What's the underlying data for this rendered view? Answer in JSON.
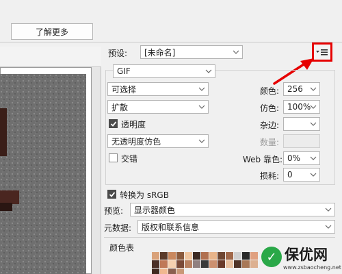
{
  "toolbar": {
    "learn_more_label": "了解更多"
  },
  "preset": {
    "label": "预设:",
    "value": "[未命名]"
  },
  "format": {
    "value": "GIF"
  },
  "palette": {
    "value": "可选择"
  },
  "dither": {
    "value": "扩散"
  },
  "transparency": {
    "label": "透明度",
    "checked": true
  },
  "matte_dither": {
    "value": "无透明度仿色"
  },
  "interlaced": {
    "label": "交错",
    "checked": false
  },
  "colors": {
    "label": "颜色:",
    "value": "256"
  },
  "dither_amount": {
    "label": "仿色:",
    "value": "100%"
  },
  "matte": {
    "label": "杂边:",
    "value": ""
  },
  "amount": {
    "label": "数量:",
    "value": ""
  },
  "web_snap": {
    "label": "Web 靠色:",
    "value": "0%"
  },
  "lossy": {
    "label": "损耗:",
    "value": "0"
  },
  "convert_srgb": {
    "label": "转换为 sRGB",
    "checked": true
  },
  "preview_mode": {
    "label": "预览:",
    "value": "显示器颜色"
  },
  "metadata": {
    "label": "元数据:",
    "value": "版权和联系信息"
  },
  "color_table": {
    "label": "颜色表",
    "swatches": [
      "#d9a27a",
      "#5a3a2a",
      "#c9885e",
      "#8a5a3c",
      "#f0c6a0",
      "#3c2a22",
      "#b07050",
      "#e8b48a",
      "#6e4632",
      "#a0684a",
      "#d0d0d0",
      "#2a2a2a",
      "#e0a080",
      "#4a3028",
      "#c07858",
      "#f5d0b0",
      "#7a4a38",
      "#b88060",
      "#908080",
      "#3a3a3a",
      "#cc9070",
      "#6a3a2a",
      "#e8c0a0",
      "#503428",
      "#a87858",
      "#dcb090",
      "#402820",
      "#f0b890",
      "#8a6050",
      "#c89878"
    ]
  },
  "watermark": {
    "title": "保优网",
    "url": "www.zsbaocheng.net",
    "logo_char": "✓"
  },
  "colors_theme": {
    "highlight": "#e60000",
    "logo_green": "#2aa848"
  }
}
